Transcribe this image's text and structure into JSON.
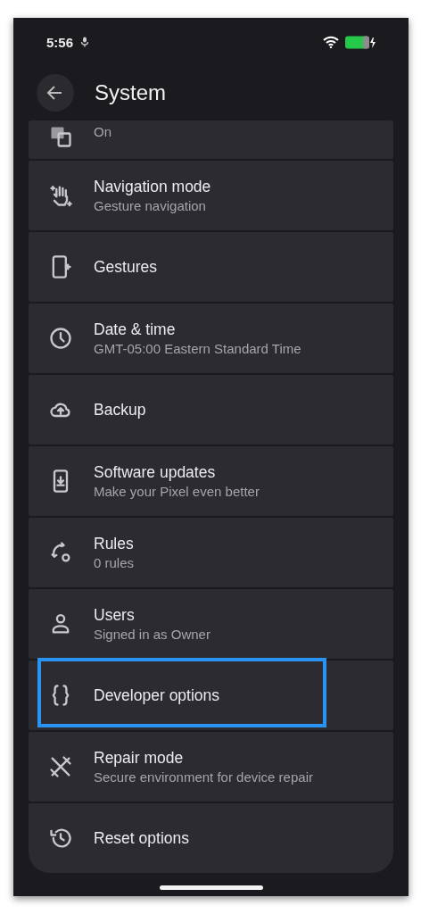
{
  "status_bar": {
    "time": "5:56"
  },
  "header": {
    "title": "System"
  },
  "items": [
    {
      "subtitle": "On",
      "highlighted": false
    },
    {
      "title": "Navigation mode",
      "subtitle": "Gesture navigation",
      "highlighted": false
    },
    {
      "title": "Gestures",
      "highlighted": false
    },
    {
      "title": "Date & time",
      "subtitle": "GMT-05:00 Eastern Standard Time",
      "highlighted": false
    },
    {
      "title": "Backup",
      "highlighted": false
    },
    {
      "title": "Software updates",
      "subtitle": "Make your Pixel even better",
      "highlighted": false
    },
    {
      "title": "Rules",
      "subtitle": "0 rules",
      "highlighted": false
    },
    {
      "title": "Users",
      "subtitle": "Signed in as Owner",
      "highlighted": false
    },
    {
      "title": "Developer options",
      "highlighted": true
    },
    {
      "title": "Repair mode",
      "subtitle": "Secure environment for device repair",
      "highlighted": false
    },
    {
      "title": "Reset options",
      "highlighted": false
    }
  ]
}
